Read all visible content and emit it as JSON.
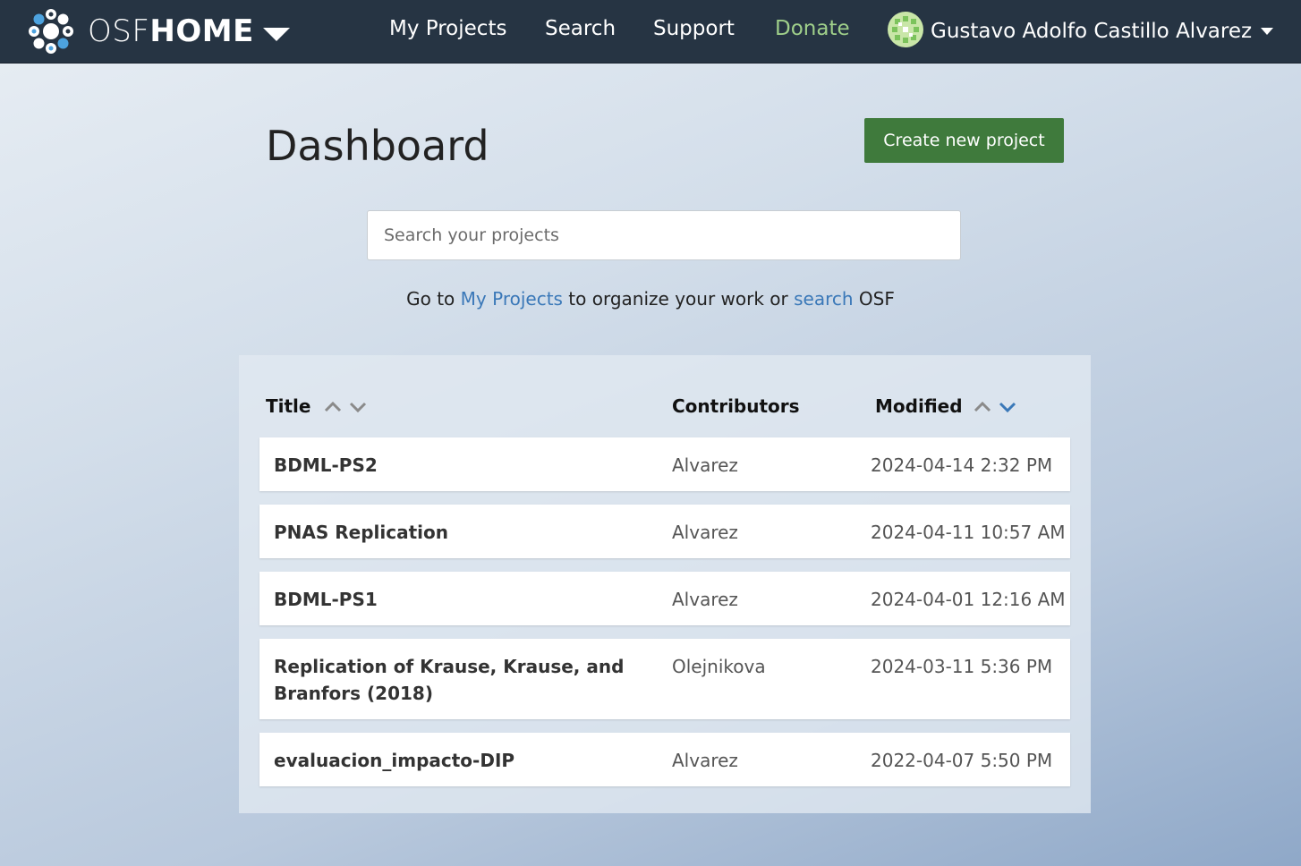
{
  "navbar": {
    "brand_osf": "OSF",
    "brand_home": "HOME",
    "links": {
      "my_projects": "My Projects",
      "search": "Search",
      "support": "Support",
      "donate": "Donate"
    },
    "user_name": "Gustavo Adolfo Castillo Alvarez"
  },
  "page": {
    "title": "Dashboard",
    "create_button": "Create new project",
    "search_placeholder": "Search your projects",
    "hint": {
      "prefix": "Go to ",
      "my_projects_link": "My Projects",
      "middle": " to organize your work or ",
      "search_link": "search",
      "suffix": " OSF"
    }
  },
  "table": {
    "headers": {
      "title": "Title",
      "contributors": "Contributors",
      "modified": "Modified"
    },
    "active_sort": "modified-descending",
    "rows": [
      {
        "title": "BDML-PS2",
        "contributors": "Alvarez",
        "modified": "2024-04-14 2:32 PM"
      },
      {
        "title": "PNAS Replication",
        "contributors": "Alvarez",
        "modified": "2024-04-11 10:57 AM"
      },
      {
        "title": "BDML-PS1",
        "contributors": "Alvarez",
        "modified": "2024-04-01 12:16 AM"
      },
      {
        "title": "Replication of Krause, Krause, and Branfors (2018)",
        "contributors": "Olejnikova",
        "modified": "2024-03-11 5:36 PM"
      },
      {
        "title": "evaluacion_impacto-DIP",
        "contributors": "Alvarez",
        "modified": "2022-04-07 5:50 PM"
      }
    ]
  },
  "colors": {
    "navbar_bg": "#263443",
    "donate": "#9fcf8a",
    "create_button_bg": "#3f7a3c",
    "link": "#3a78b8",
    "active_sort_arrow": "#3a78b8",
    "inactive_sort_arrow": "#8a8a8a"
  },
  "icons": {
    "brand_logo": "osf-logo-icon",
    "brand_menu": "caret-down-icon",
    "user_avatar": "avatar-identicon",
    "user_menu": "caret-down-icon",
    "sort_up": "chevron-up-icon",
    "sort_down": "chevron-down-icon"
  }
}
